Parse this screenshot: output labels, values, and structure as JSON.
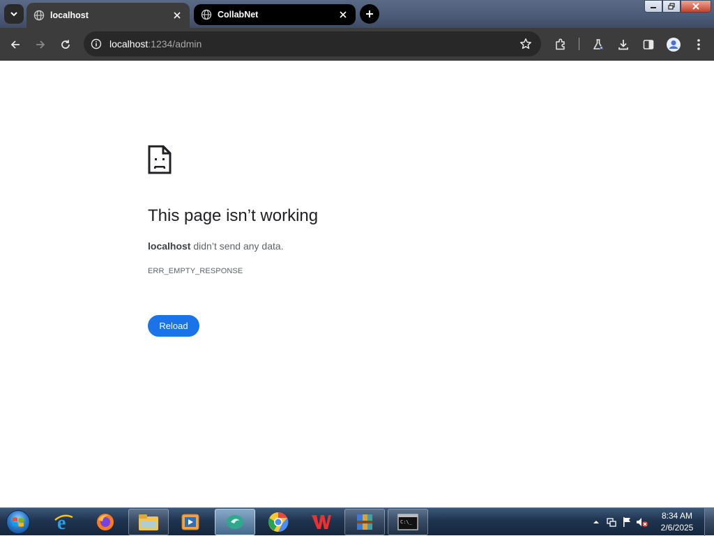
{
  "tabs": [
    {
      "title": "localhost",
      "active": true
    },
    {
      "title": "CollabNet",
      "active": false
    }
  ],
  "address_bar": {
    "host": "localhost",
    "path": ":1234/admin"
  },
  "error_page": {
    "title": "This page isn’t working",
    "host": "localhost",
    "message": " didn’t send any data.",
    "code": "ERR_EMPTY_RESPONSE",
    "reload_label": "Reload"
  },
  "taskbar": {
    "apps": [
      {
        "name": "internet-explorer-icon"
      },
      {
        "name": "firefox-icon"
      },
      {
        "name": "file-explorer-icon"
      },
      {
        "name": "media-player-icon"
      },
      {
        "name": "app-icon"
      },
      {
        "name": "chrome-icon"
      },
      {
        "name": "wps-office-icon"
      },
      {
        "name": "winrar-icon"
      },
      {
        "name": "command-prompt-icon"
      }
    ],
    "clock": {
      "time": "8:34 AM",
      "date": "2/6/2025"
    }
  },
  "colors": {
    "accent": "#1a73e8",
    "toolbar": "#3c3c3c",
    "omnibox": "#282828"
  }
}
